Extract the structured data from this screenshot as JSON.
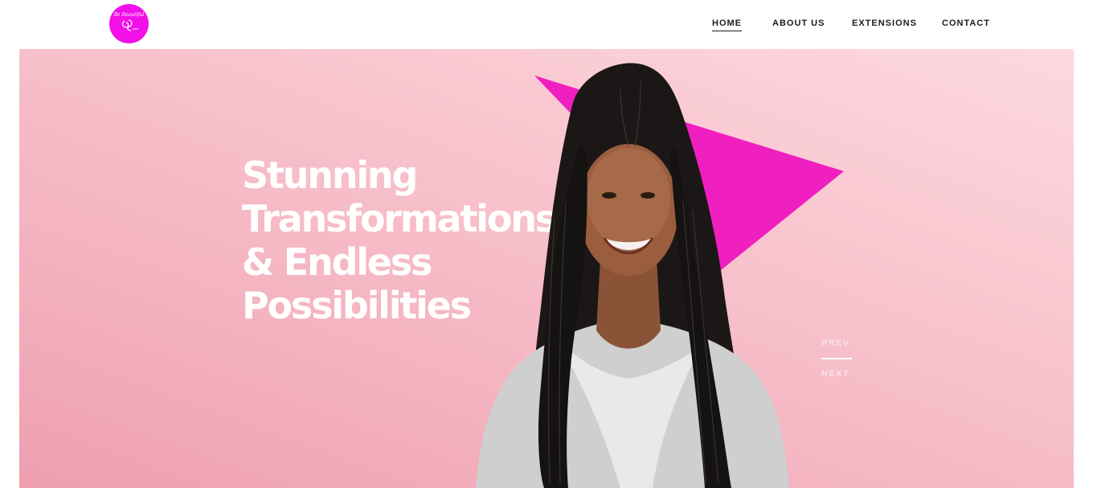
{
  "logo": {
    "text": "Be Beautiful",
    "subtext": ""
  },
  "nav": {
    "items": [
      {
        "label": "HOME",
        "active": true
      },
      {
        "label": "ABOUT US",
        "active": false
      },
      {
        "label": "EXTENSIONS",
        "active": false
      },
      {
        "label": "CONTACT",
        "active": false
      }
    ]
  },
  "hero": {
    "headline_lines": [
      "Stunning",
      "Transformations",
      "& Endless",
      "Possibilities"
    ],
    "prev_label": "PREV",
    "next_label": "NEXT"
  },
  "colors": {
    "brand": "#f20fe8",
    "triangle": "#ef1fc0",
    "hero_bg_light": "#fdd9df",
    "hero_bg_dark": "#ee9fb0",
    "nav_text": "#1c1c1c"
  },
  "icons": {
    "logo": "be-beautiful-logo-icon"
  }
}
